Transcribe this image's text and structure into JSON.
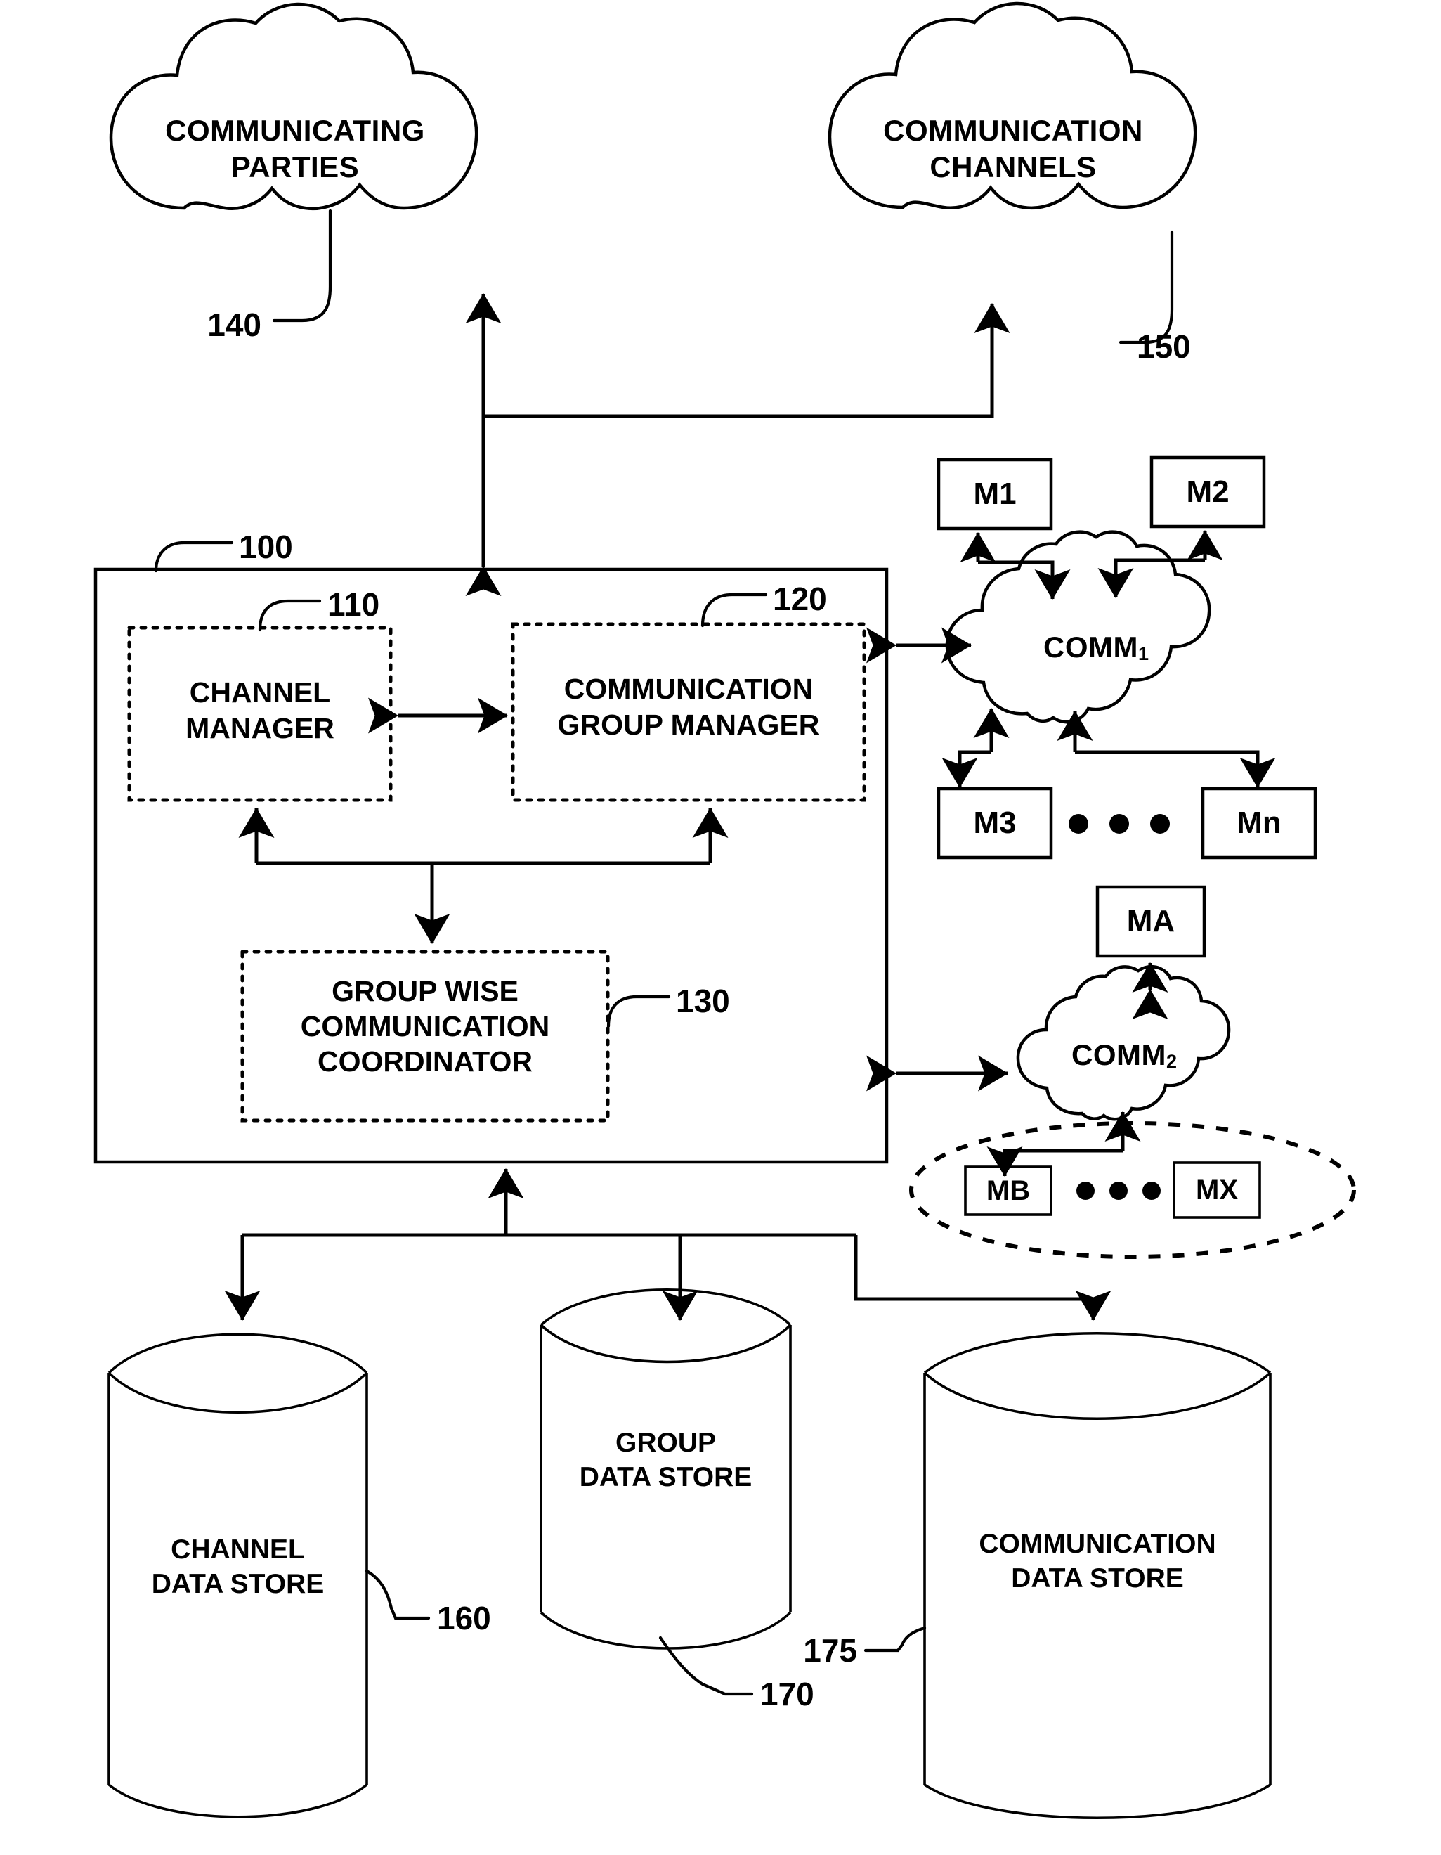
{
  "figure": {
    "domain": "patent-system-block-diagram",
    "clouds": [
      {
        "id": "communicating-parties",
        "label_line1": "COMMUNICATING",
        "label_line2": "PARTIES",
        "ref": "140"
      },
      {
        "id": "communication-channels",
        "label_line1": "COMMUNICATION",
        "label_line2": "CHANNELS",
        "ref": "150"
      }
    ],
    "system": {
      "ref": "100",
      "modules": [
        {
          "id": "channel-manager",
          "label_line1": "CHANNEL",
          "label_line2": "MANAGER",
          "label_line3": "",
          "ref": "110"
        },
        {
          "id": "communication-group-manager",
          "label_line1": "COMMUNICATION",
          "label_line2": "GROUP MANAGER",
          "label_line3": "",
          "ref": "120"
        },
        {
          "id": "group-wise-communication-coordinator",
          "label_line1": "GROUP WISE",
          "label_line2": "COMMUNICATION",
          "label_line3": "COORDINATOR",
          "ref": "130"
        }
      ]
    },
    "networks": [
      {
        "id": "comm-1",
        "label": "COMM",
        "subscript": "1"
      },
      {
        "id": "comm-2",
        "label": "COMM",
        "subscript": "2"
      }
    ],
    "members": {
      "comm1_top": [
        {
          "id": "m1",
          "label": "M1"
        },
        {
          "id": "m2",
          "label": "M2"
        }
      ],
      "comm1_bottom": [
        {
          "id": "m3",
          "label": "M3"
        },
        {
          "id": "mn",
          "label": "Mn"
        }
      ],
      "comm1_bottom_ellipsis": "• • •",
      "comm2_top": [
        {
          "id": "ma",
          "label": "MA"
        }
      ],
      "comm2_group": [
        {
          "id": "mb",
          "label": "MB"
        },
        {
          "id": "mx",
          "label": "MX"
        }
      ],
      "comm2_group_ellipsis": "• • •"
    },
    "data_stores": [
      {
        "id": "channel-data-store",
        "label_line1": "CHANNEL",
        "label_line2": "DATA STORE",
        "ref": "160"
      },
      {
        "id": "group-data-store",
        "label_line1": "GROUP",
        "label_line2": "DATA STORE",
        "ref": "170"
      },
      {
        "id": "communication-data-store",
        "label_line1": "COMMUNICATION",
        "label_line2": "DATA STORE",
        "ref": "175"
      }
    ],
    "colors": {
      "ink": "#000000",
      "paper": "#ffffff"
    }
  }
}
